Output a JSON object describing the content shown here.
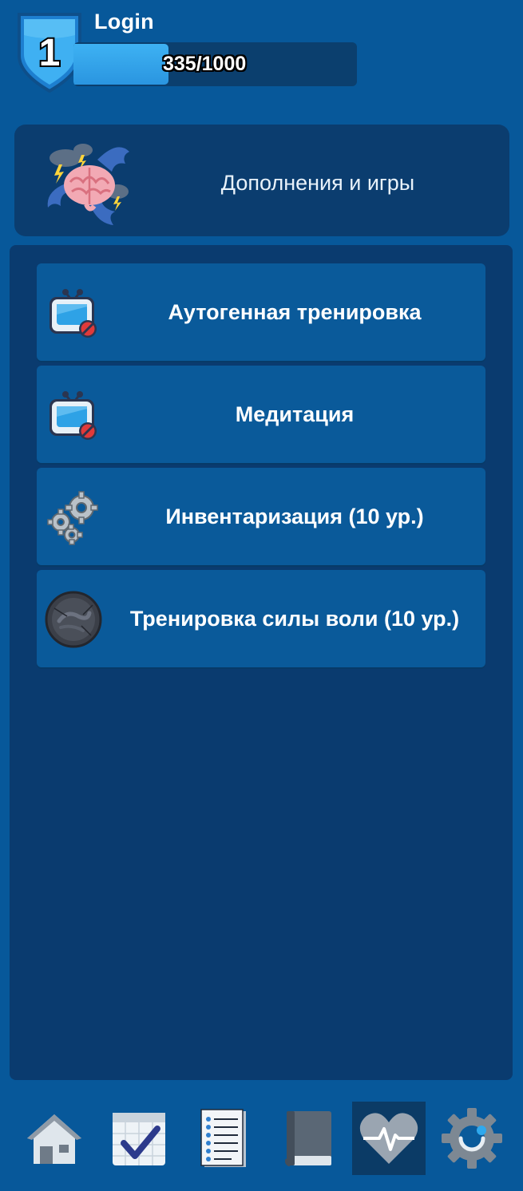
{
  "header": {
    "level": "1",
    "username": "Login",
    "xp_text": "335/1000",
    "xp_progress": 0.335
  },
  "addons": {
    "title": "Дополнения и игры",
    "icon": "brain-storm-icon"
  },
  "menu": {
    "items": [
      {
        "label": "Аутогенная тренировка",
        "icon": "tv-blocked-icon"
      },
      {
        "label": "Медитация",
        "icon": "tv-blocked-icon"
      },
      {
        "label": "Инвентаризация (10 ур.)",
        "icon": "gears-icon"
      },
      {
        "label": "Тренировка силы воли (10 ур.)",
        "icon": "locked-orb-icon"
      }
    ]
  },
  "nav": {
    "items": [
      {
        "icon": "home-icon",
        "active": false
      },
      {
        "icon": "calendar-check-icon",
        "active": false
      },
      {
        "icon": "checklist-icon",
        "active": false
      },
      {
        "icon": "journal-book-icon",
        "active": false
      },
      {
        "icon": "heart-pulse-icon",
        "active": true
      },
      {
        "icon": "settings-gear-icon",
        "active": false
      }
    ]
  },
  "colors": {
    "background": "#07589a",
    "panel": "#0a3b6f",
    "menu_item": "#0a5a9a",
    "xp_fill": "#3eb2f3",
    "badge": "#2a9be8"
  }
}
